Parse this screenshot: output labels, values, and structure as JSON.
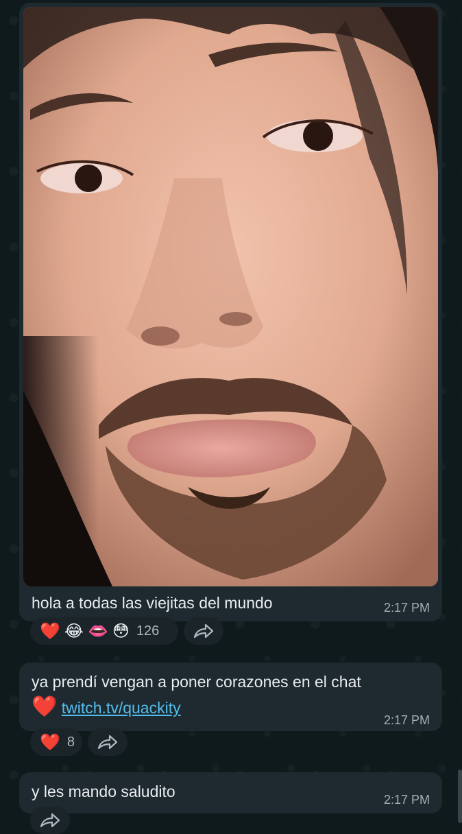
{
  "messages": [
    {
      "caption": "hola a todas las viejitas del mundo",
      "time": "2:17 PM",
      "reactions": [
        "❤️",
        "😂",
        "👄",
        "😳"
      ],
      "reaction_count": "126"
    },
    {
      "text": "ya prendí vengan a poner corazones en el chat",
      "heart": "❤️",
      "link": "twitch.tv/quackity",
      "time": "2:17 PM",
      "reactions": [
        "❤️"
      ],
      "reaction_count": "8"
    },
    {
      "text": "y les mando saludito",
      "time": "2:17 PM"
    }
  ],
  "colors": {
    "bubble": "#1e2a30",
    "background": "#0f1a1d",
    "link": "#53bdeb"
  },
  "icons": {
    "forward": "forward-arrow-icon"
  }
}
